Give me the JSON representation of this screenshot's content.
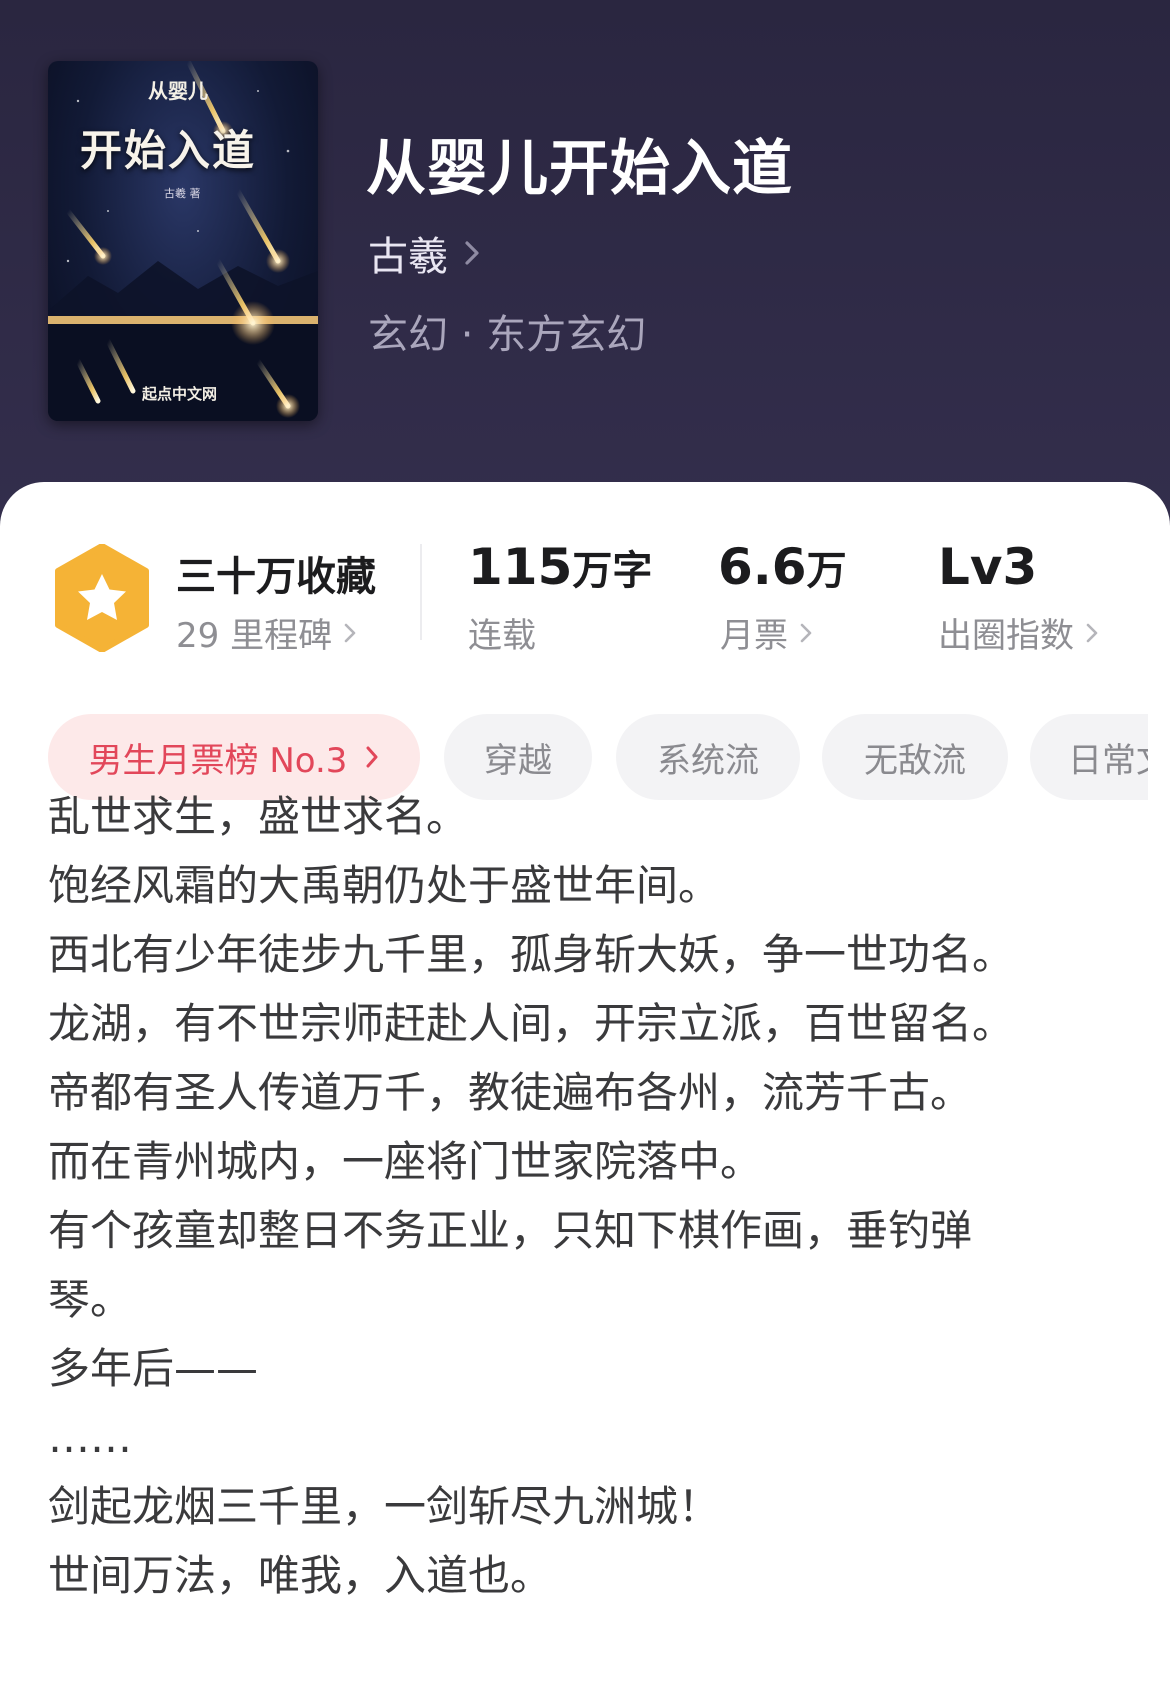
{
  "book": {
    "title": "从婴儿开始入道",
    "author": "古羲",
    "genre": "玄幻 · 东方玄幻"
  },
  "cover": {
    "series_text": "从婴儿",
    "title_text": "开始入道",
    "author_text": "古羲 著",
    "publisher_text": "起点中文网"
  },
  "stats": {
    "favorites": {
      "value": "三十万收藏",
      "sub": "29 里程碑"
    },
    "words": {
      "value_num": "115",
      "value_unit": "万字",
      "sub": "连载"
    },
    "tickets": {
      "value_num": "6.6",
      "value_unit": "万",
      "sub": "月票"
    },
    "level": {
      "value": "Lv3",
      "sub": "出圈指数"
    }
  },
  "tags": [
    "男生月票榜 No.3",
    "穿越",
    "系统流",
    "无敌流",
    "日常文"
  ],
  "description": [
    "乱世求生，盛世求名。",
    "饱经风霜的大禹朝仍处于盛世年间。",
    "西北有少年徒步九千里，孤身斩大妖，争一世功名。",
    "龙湖，有不世宗师赶赴人间，开宗立派，百世留名。",
    "帝都有圣人传道万千，教徒遍布各州，流芳千古。",
    "而在青州城内，一座将门世家院落中。",
    "有个孩童却整日不务正业，只知下棋作画，垂钓弹",
    "琴。",
    "多年后——",
    "……",
    "剑起龙烟三千里，一剑斩尽九洲城！",
    "世间万法，唯我，入道也。"
  ],
  "colors": {
    "header_bg": "#2d2944",
    "rank_tag_bg": "#fde9e9",
    "rank_tag_text": "#e2475a",
    "badge": "#f5b336"
  }
}
